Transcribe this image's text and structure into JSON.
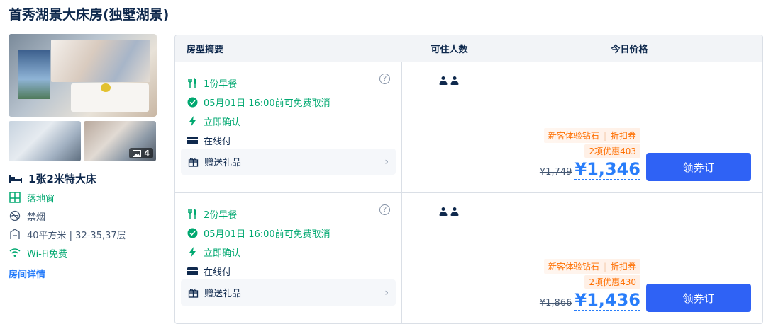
{
  "room": {
    "title": "首秀湖景大床房(独墅湖景)",
    "photo_count": "4",
    "bed": "1张2米特大床",
    "features": [
      {
        "label": "落地窗",
        "icon": "window-icon",
        "color": "#00a870"
      },
      {
        "label": "禁烟",
        "icon": "no-smoking-icon",
        "color": "#455873"
      },
      {
        "label": "40平方米 | 32-35,37层",
        "icon": "area-icon",
        "color": "#455873"
      },
      {
        "label": "Wi-Fi免费",
        "icon": "wifi-icon",
        "color": "#00a870"
      }
    ],
    "detail_link": "房间详情"
  },
  "table": {
    "headers": {
      "summary": "房型摘要",
      "guests": "可住人数",
      "price": "今日价格"
    },
    "rows": [
      {
        "breakfast": "1份早餐",
        "cancel": "05月01日 16:00前可免费取消",
        "confirm": "立即确认",
        "payment": "在线付",
        "gift": "赠送礼品",
        "guests": 2,
        "promo_tag1": "新客体验钻石",
        "promo_tag2": "折扣券",
        "discount": "2项优惠403",
        "original_price": "¥1,749",
        "price": "¥1,346",
        "book_label": "领券订"
      },
      {
        "breakfast": "2份早餐",
        "cancel": "05月01日 16:00前可免费取消",
        "confirm": "立即确认",
        "payment": "在线付",
        "gift": "赠送礼品",
        "guests": 2,
        "promo_tag1": "新客体验钻石",
        "promo_tag2": "折扣券",
        "discount": "2项优惠430",
        "original_price": "¥1,866",
        "price": "¥1,436",
        "book_label": "领券订"
      }
    ]
  },
  "colors": {
    "accent": "#287dfa",
    "green": "#00a870",
    "orange": "#ff6f00",
    "button": "#2f62f5"
  }
}
